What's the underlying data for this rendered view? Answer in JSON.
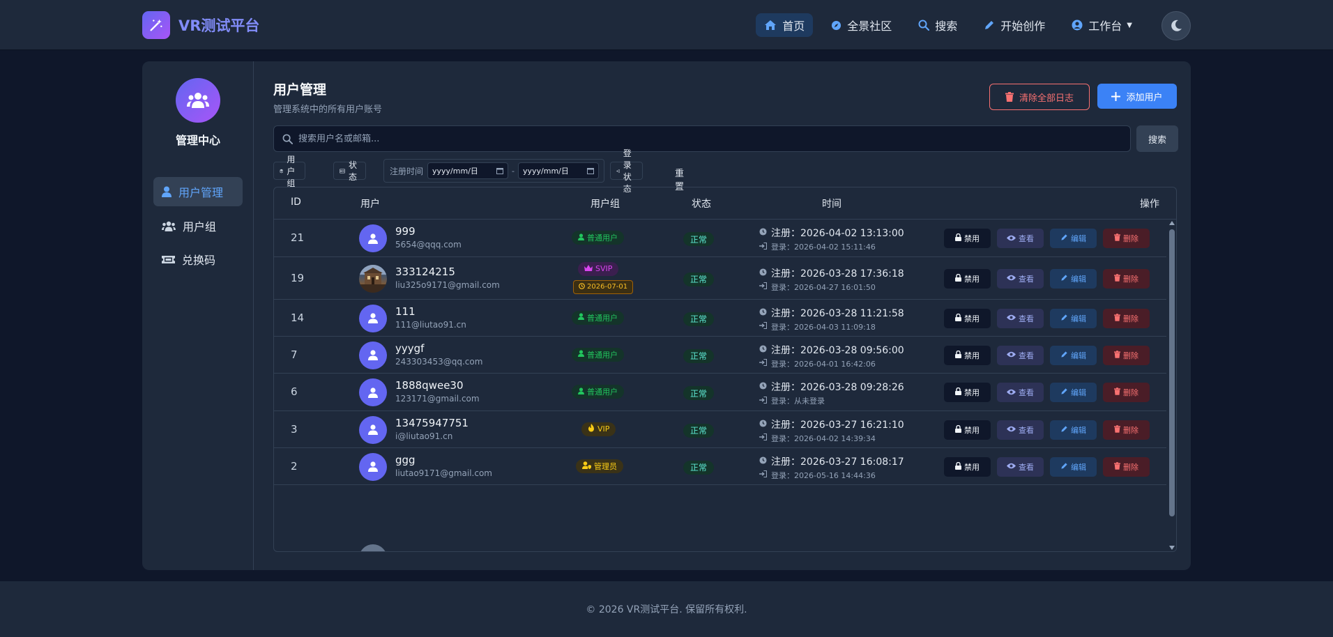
{
  "brand": {
    "name": "VR测试平台"
  },
  "nav": {
    "home": "首页",
    "community": "全景社区",
    "search": "搜索",
    "create": "开始创作",
    "workbench": "工作台"
  },
  "sidebar": {
    "title": "管理中心",
    "items": [
      {
        "label": "用户管理",
        "icon": "user-icon",
        "active": true
      },
      {
        "label": "用户组",
        "icon": "users-icon"
      },
      {
        "label": "兑换码",
        "icon": "ticket-icon"
      }
    ]
  },
  "page": {
    "title": "用户管理",
    "subtitle": "管理系统中的所有用户账号",
    "clear_logs_label": "清除全部日志",
    "add_user_label": "添加用户"
  },
  "search": {
    "placeholder": "搜索用户名或邮箱...",
    "button_label": "搜索"
  },
  "filters": {
    "group_label": "用户组",
    "status_label": "状态",
    "reg_time_label": "注册时间",
    "date_from": "yyyy/mm/日",
    "date_to": "yyyy/mm/日",
    "date_separator": "-",
    "login_status_label": "登录状态",
    "reset_label": "重置"
  },
  "table": {
    "columns": {
      "id": "ID",
      "user": "用户",
      "group": "用户组",
      "status": "状态",
      "time": "时间",
      "actions": "操作"
    },
    "actions": {
      "ban": "禁用",
      "view": "查看",
      "edit": "编辑",
      "delete": "删除"
    },
    "rows": [
      {
        "id": "21",
        "name": "999",
        "email": "5654@qqq.com",
        "group": "普通用户",
        "status": "正常",
        "reg": "注册：2026-04-02 13:13:00",
        "login": "登录：2026-04-02 15:11:46"
      },
      {
        "id": "19",
        "name": "333124215",
        "email": "liu325o9171@gmail.com",
        "group": "SVIP",
        "expiry": "2026-07-01",
        "status": "正常",
        "reg": "注册：2026-03-28 17:36:18",
        "login": "登录：2026-04-27 16:01:50"
      },
      {
        "id": "14",
        "name": "111",
        "email": "111@liutao91.cn",
        "group": "普通用户",
        "status": "正常",
        "reg": "注册：2026-03-28 11:21:58",
        "login": "登录：2026-04-03 11:09:18"
      },
      {
        "id": "7",
        "name": "yyygf",
        "email": "243303453@qq.com",
        "group": "普通用户",
        "status": "正常",
        "reg": "注册：2026-03-28 09:56:00",
        "login": "登录：2026-04-01 16:42:06"
      },
      {
        "id": "6",
        "name": "1888qwee30",
        "email": "123171@gmail.com",
        "group": "普通用户",
        "status": "正常",
        "reg": "注册：2026-03-28 09:28:26",
        "login": "登录：从未登录"
      },
      {
        "id": "3",
        "name": "13475947751",
        "email": "i@liutao91.cn",
        "group": "VIP",
        "status": "正常",
        "reg": "注册：2026-03-27 16:21:10",
        "login": "登录：2026-04-02 14:39:34"
      },
      {
        "id": "2",
        "name": "ggg",
        "email": "liutao9171@gmail.com",
        "group": "管理员",
        "status": "正常",
        "reg": "注册：2026-03-27 16:08:17",
        "login": "登录：2026-05-16 14:44:36"
      }
    ]
  },
  "footer": {
    "text": "© 2026 VR测试平台. 保留所有权利."
  },
  "colors": {
    "accent": "#3b82f6",
    "brand": "#818cf8",
    "danger": "#f87171",
    "success": "#22c55e"
  }
}
